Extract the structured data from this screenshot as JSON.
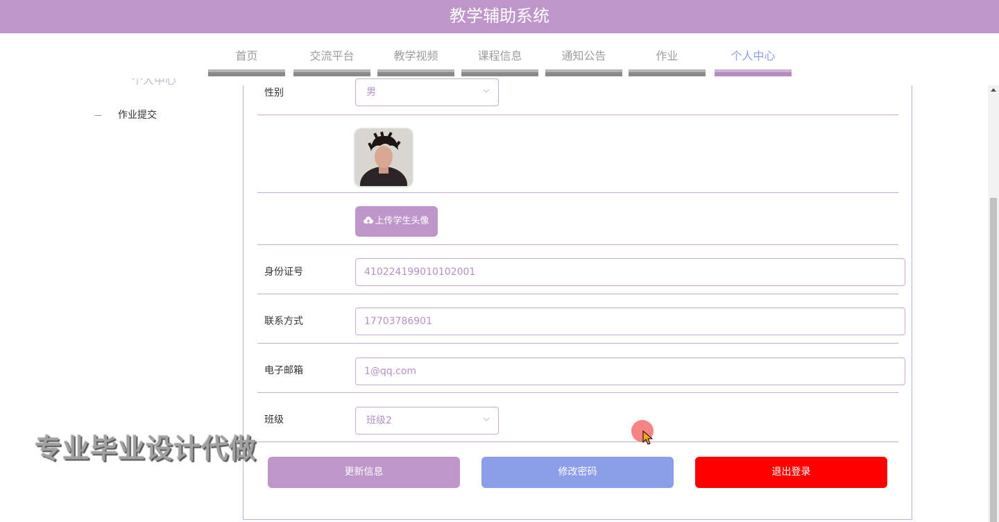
{
  "app": {
    "title": "教学辅助系统"
  },
  "nav": {
    "items": [
      {
        "label": "首页"
      },
      {
        "label": "交流平台"
      },
      {
        "label": "教学视频"
      },
      {
        "label": "课程信息"
      },
      {
        "label": "通知公告"
      },
      {
        "label": "作业"
      },
      {
        "label": "个人中心"
      }
    ],
    "active_index": 6
  },
  "sidebar": {
    "partial_title": "个人中心",
    "items": [
      {
        "label": "作业提交"
      }
    ]
  },
  "form": {
    "gender": {
      "label": "性别",
      "value": "男"
    },
    "avatar": {
      "icon": "user-photo"
    },
    "upload_button": {
      "label": "上传学生头像",
      "icon": "cloud-upload-icon"
    },
    "id_number": {
      "label": "身份证号",
      "value": "410224199010102001"
    },
    "phone": {
      "label": "联系方式",
      "value": "17703786901"
    },
    "email": {
      "label": "电子邮箱",
      "value": "1@qq.com"
    },
    "class": {
      "label": "班级",
      "value": "班级2"
    }
  },
  "actions": {
    "update": {
      "label": "更新信息",
      "color": "#bf96c9"
    },
    "change_password": {
      "label": "修改密码",
      "color": "#8c9ee9"
    },
    "logout": {
      "label": "退出登录",
      "color": "#ff0000"
    }
  },
  "watermark": {
    "text": "专业毕业设计代做"
  },
  "colors": {
    "header": "#bf96c9",
    "active_nav": "#8c9ee9"
  }
}
